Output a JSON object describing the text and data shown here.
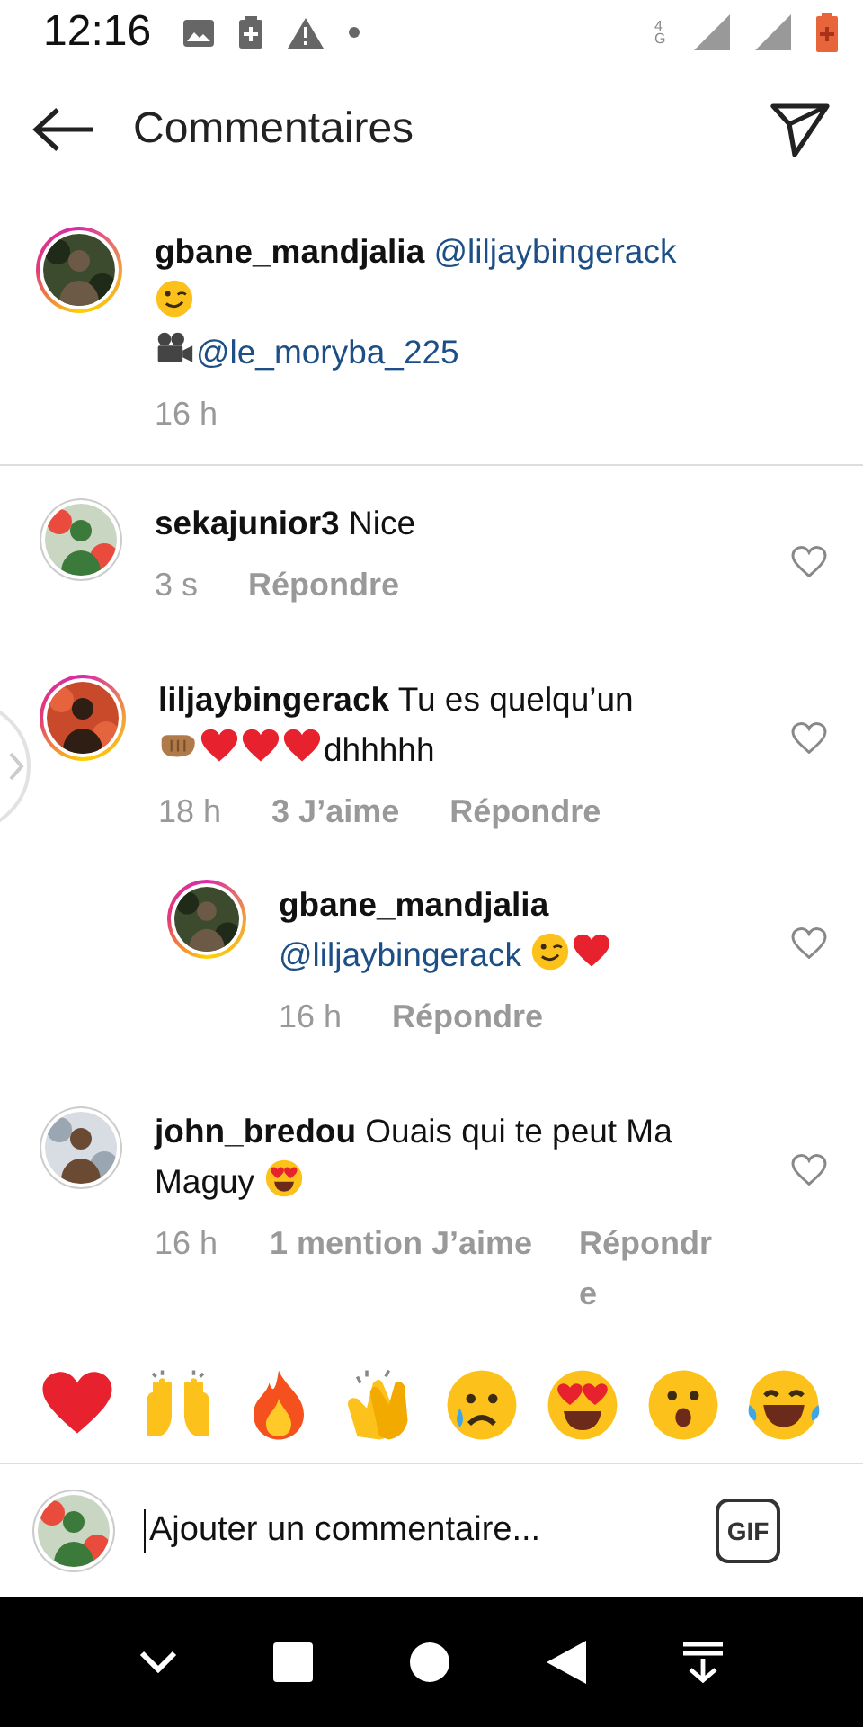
{
  "status_bar": {
    "time": "12:16",
    "network": "4G"
  },
  "header": {
    "title": "Commentaires"
  },
  "caption": {
    "user": "gbane_mandjalia",
    "story_ring": true,
    "time": "16 h",
    "body": [
      {
        "kind": "mention",
        "text": "@liljaybingerack"
      },
      {
        "kind": "break"
      },
      {
        "kind": "wink"
      },
      {
        "kind": "break"
      },
      {
        "kind": "camera"
      },
      {
        "kind": "mention",
        "text": "@le_moryba_225"
      }
    ]
  },
  "comments": [
    {
      "user": "sekajunior3",
      "story_ring": false,
      "liked": false,
      "time": "3 s",
      "reply": "Répondre",
      "wrapped_meta": false,
      "body": [
        {
          "kind": "text",
          "text": "Nice"
        }
      ]
    },
    {
      "user": "liljaybingerack",
      "story_ring": true,
      "liked": false,
      "time": "18 h",
      "likes": "3 J’aime",
      "reply": "Répondre",
      "wrapped_meta": false,
      "body": [
        {
          "kind": "text",
          "text": "Tu es quelqu’un"
        },
        {
          "kind": "break"
        },
        {
          "kind": "fist"
        },
        {
          "kind": "heart"
        },
        {
          "kind": "heart"
        },
        {
          "kind": "heart"
        },
        {
          "kind": "text",
          "text": "dhhhhh"
        }
      ],
      "children": [
        {
          "user": "gbane_mandjalia",
          "story_ring": true,
          "liked": false,
          "time": "16 h",
          "reply": "Répondre",
          "wrapped_meta": false,
          "body": [
            {
              "kind": "break"
            },
            {
              "kind": "mention",
              "text": "@liljaybingerack"
            },
            {
              "kind": "wink"
            },
            {
              "kind": "heart"
            }
          ]
        }
      ]
    },
    {
      "user": "john_bredou",
      "story_ring": false,
      "liked": false,
      "time": "16 h",
      "likes": "1 mention J’aime",
      "reply": "Répondre",
      "wrapped_meta": true,
      "body": [
        {
          "kind": "text",
          "text": "Ouais qui te peut Ma Maguy"
        },
        {
          "kind": "heart-eyes"
        }
      ]
    }
  ],
  "reactions": [
    {
      "kind": "heart"
    },
    {
      "kind": "raised-hands"
    },
    {
      "kind": "fire"
    },
    {
      "kind": "clap"
    },
    {
      "kind": "sad"
    },
    {
      "kind": "heart-eyes"
    },
    {
      "kind": "surprised"
    },
    {
      "kind": "laugh"
    }
  ],
  "composer": {
    "placeholder": "Ajouter un commentaire...",
    "gif": "GIF"
  }
}
